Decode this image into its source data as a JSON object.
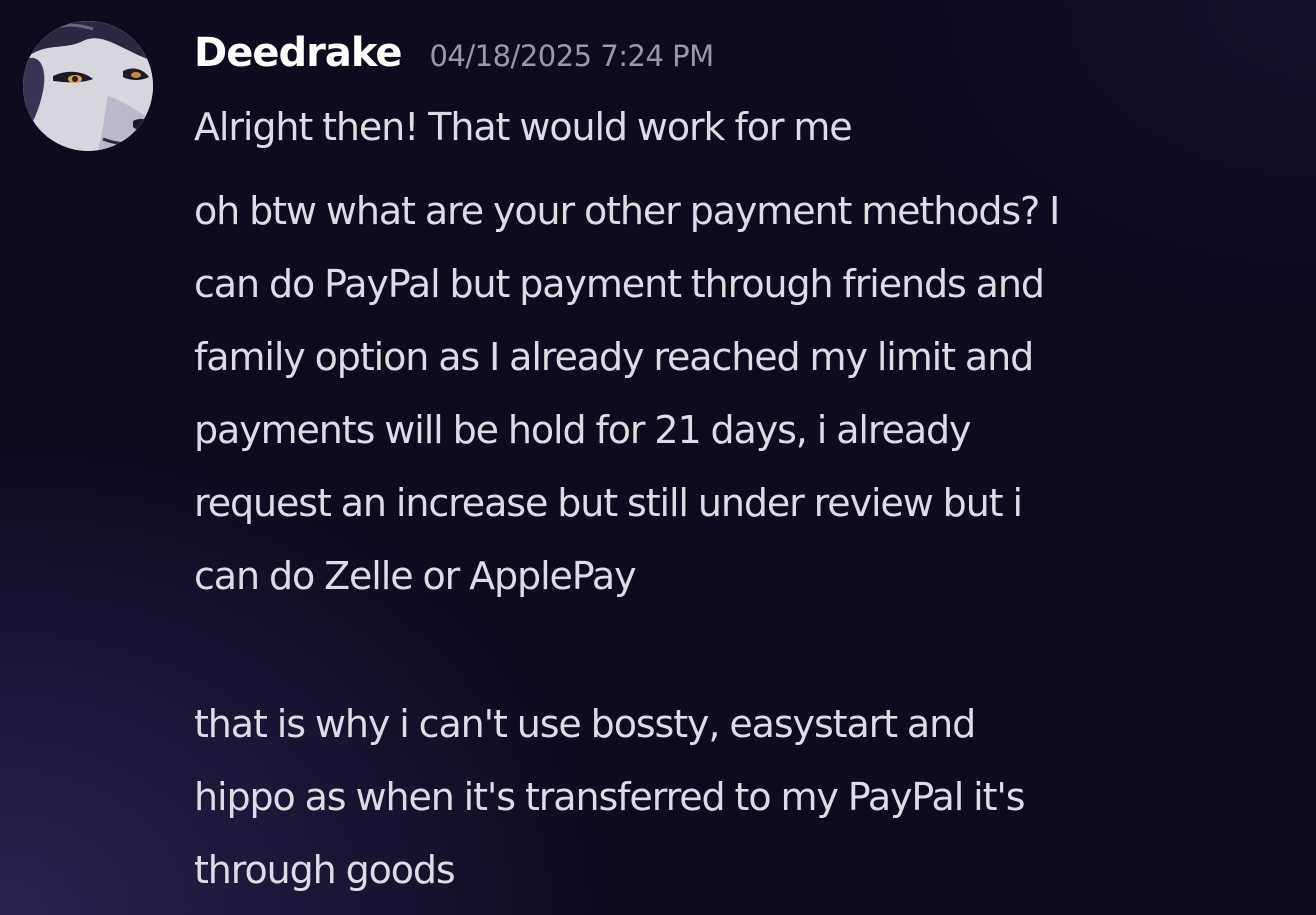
{
  "message": {
    "author": "Deedrake",
    "timestamp": "04/18/2025 7:24 PM",
    "first_line": "Alright then! That would work for me",
    "paragraph_1": [
      "oh btw what are your other payment methods? I",
      "can do PayPal but  payment through friends and",
      "family option as I already reached my limit and",
      "payments will be hold for 21 days, i already",
      "request an increase but still under review but i",
      "can do Zelle or ApplePay"
    ],
    "paragraph_2": [
      "that is why i can't use bossty, easystart and",
      "hippo as when it's transferred to my PayPal it's",
      "through goods"
    ]
  },
  "colors": {
    "background": "#0d0b1e",
    "username": "#ffffff",
    "timestamp": "#9a98a8",
    "text": "#dddbe6"
  }
}
